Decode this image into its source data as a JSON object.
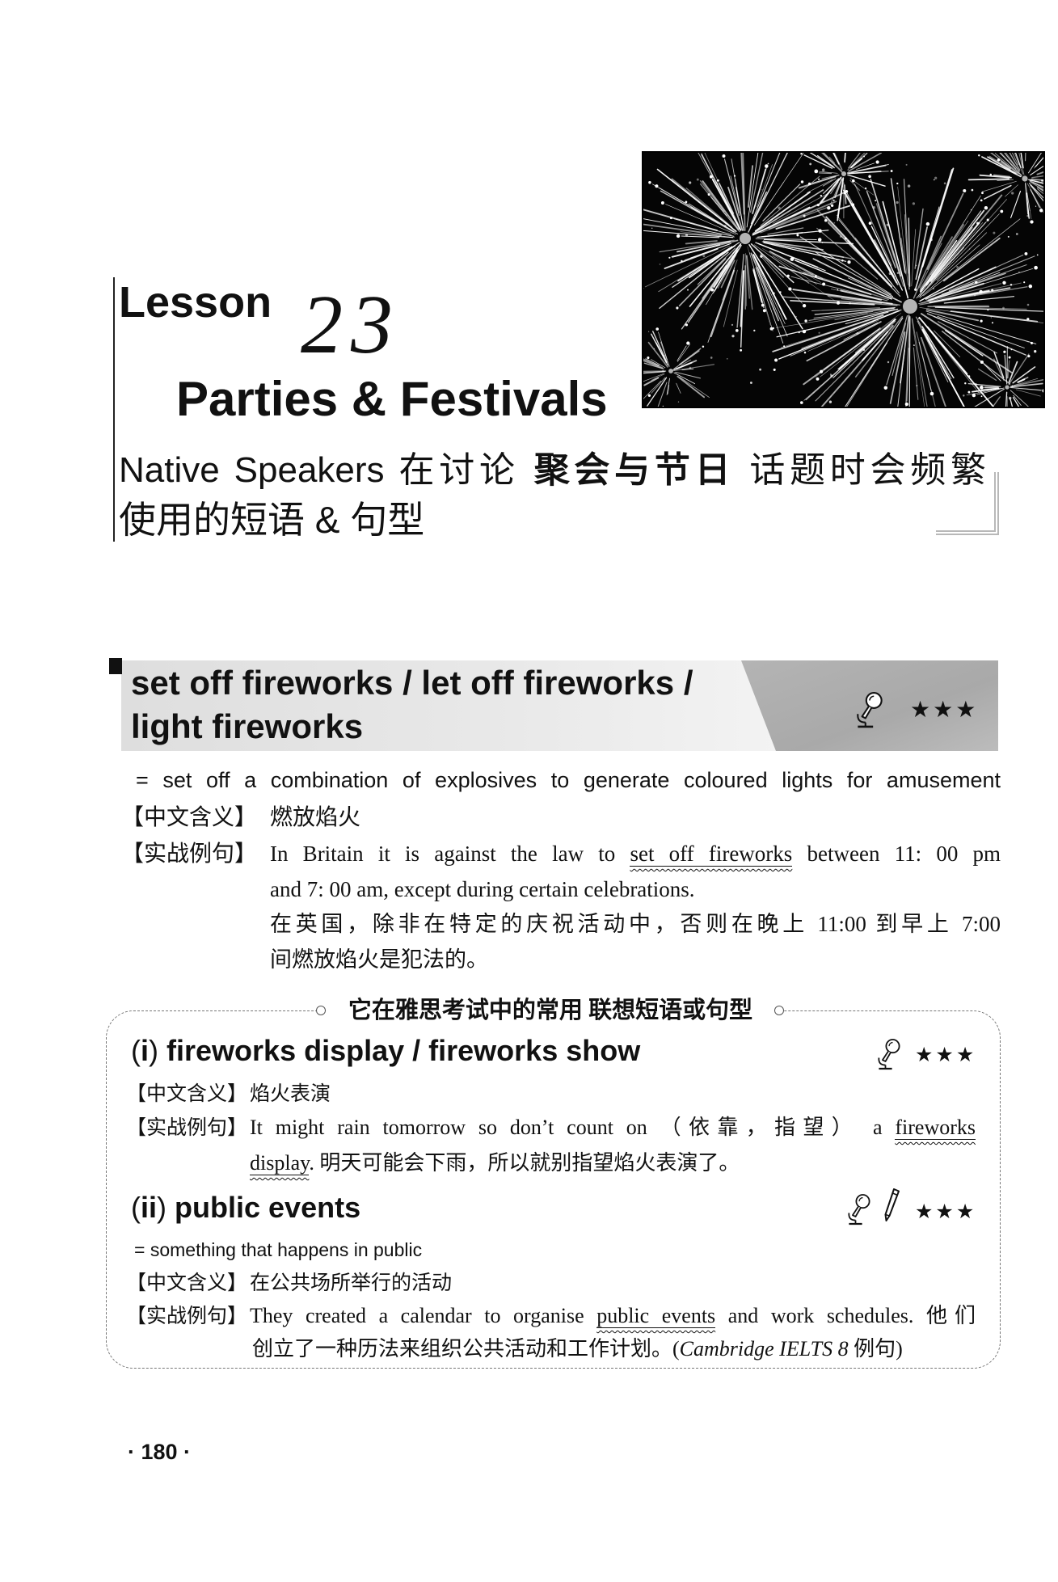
{
  "colors": {
    "ink": "#111111",
    "band_light": "#dedede",
    "band_dark": "#b4b4b4",
    "bracket": "#b8b8b8"
  },
  "lesson": {
    "label": "Lesson",
    "number": "23",
    "title": "Parties & Festivals"
  },
  "subtitle": {
    "line1_latin": "Native Speakers",
    "line1_part_a": "在讨论",
    "line1_topic": "聚会与节日",
    "line1_part_b": "话题时会频繁",
    "line2": "使用的短语 & 句型"
  },
  "main_entry": {
    "phrase_line1": "set off fireworks / let off fireworks /",
    "phrase_line2": "light fireworks",
    "icon": "microphone-icon",
    "rating": "★★★",
    "definition": "= set off a combination of explosives to generate coloured lights for amusement",
    "meaning_label": "【中文含义】",
    "meaning": "燃放焰火",
    "example_label": "【实战例句】",
    "example_line1_before": "In Britain it is against the law to",
    "example_line1_phrase": "set off fireworks",
    "example_line1_after": "between 11: 00 pm",
    "example_line2": "and 7: 00 am, except during certain celebrations.",
    "translation_line1": "在英国，除非在特定的庆祝活动中，否则在晚上 11:00 到早上 7:00",
    "translation_line2": "间燃放焰火是犯法的。"
  },
  "related_box": {
    "title_part_a": "它在雅思考试中的常用",
    "title_part_b": "联想短语或句型",
    "items": [
      {
        "index_open": "(",
        "index_num": "i",
        "index_close": ")",
        "phrase": "fireworks display / fireworks show",
        "icons": [
          "microphone-icon"
        ],
        "rating": "★★★",
        "meaning_label": "【中文含义】",
        "meaning": "焰火表演",
        "example_label": "【实战例句】",
        "example_line1_before": "It might rain tomorrow so don’t count on （依靠，指望） a",
        "example_line1_phrase": "fireworks",
        "example_line2_phrase": "display",
        "example_line2_after": ". 明天可能会下雨，所以就别指望焰火表演了。"
      },
      {
        "index_open": "(",
        "index_num": "ii",
        "index_close": ")",
        "phrase": "public events",
        "icons": [
          "microphone-icon",
          "pencil-icon"
        ],
        "rating": "★★★",
        "definition": "= something that happens in public",
        "meaning_label": "【中文含义】",
        "meaning": "在公共场所举行的活动",
        "example_label": "【实战例句】",
        "example_line1_before": "They created a calendar to organise",
        "example_line1_phrase": "public events",
        "example_line1_after": "and work schedules. 他们",
        "example_line2_before": "创立了一种历法来组织公共活动和工作计划。(",
        "example_line2_source": "Cambridge IELTS 8",
        "example_line2_after": " 例句)"
      }
    ]
  },
  "page_number": "· 180 ·"
}
